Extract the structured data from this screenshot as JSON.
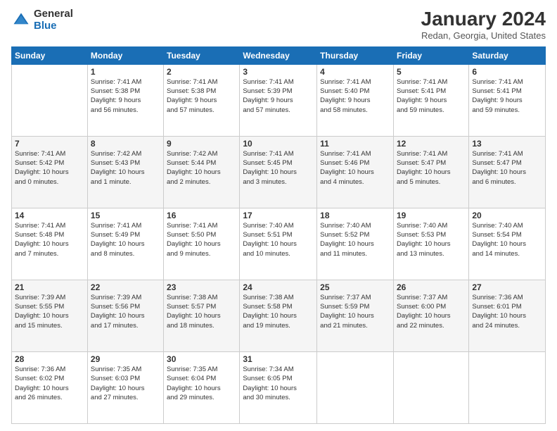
{
  "logo": {
    "general": "General",
    "blue": "Blue"
  },
  "title": "January 2024",
  "location": "Redan, Georgia, United States",
  "days_header": [
    "Sunday",
    "Monday",
    "Tuesday",
    "Wednesday",
    "Thursday",
    "Friday",
    "Saturday"
  ],
  "weeks": [
    [
      {
        "num": "",
        "info": ""
      },
      {
        "num": "1",
        "info": "Sunrise: 7:41 AM\nSunset: 5:38 PM\nDaylight: 9 hours\nand 56 minutes."
      },
      {
        "num": "2",
        "info": "Sunrise: 7:41 AM\nSunset: 5:38 PM\nDaylight: 9 hours\nand 57 minutes."
      },
      {
        "num": "3",
        "info": "Sunrise: 7:41 AM\nSunset: 5:39 PM\nDaylight: 9 hours\nand 57 minutes."
      },
      {
        "num": "4",
        "info": "Sunrise: 7:41 AM\nSunset: 5:40 PM\nDaylight: 9 hours\nand 58 minutes."
      },
      {
        "num": "5",
        "info": "Sunrise: 7:41 AM\nSunset: 5:41 PM\nDaylight: 9 hours\nand 59 minutes."
      },
      {
        "num": "6",
        "info": "Sunrise: 7:41 AM\nSunset: 5:41 PM\nDaylight: 9 hours\nand 59 minutes."
      }
    ],
    [
      {
        "num": "7",
        "info": "Sunrise: 7:41 AM\nSunset: 5:42 PM\nDaylight: 10 hours\nand 0 minutes."
      },
      {
        "num": "8",
        "info": "Sunrise: 7:42 AM\nSunset: 5:43 PM\nDaylight: 10 hours\nand 1 minute."
      },
      {
        "num": "9",
        "info": "Sunrise: 7:42 AM\nSunset: 5:44 PM\nDaylight: 10 hours\nand 2 minutes."
      },
      {
        "num": "10",
        "info": "Sunrise: 7:41 AM\nSunset: 5:45 PM\nDaylight: 10 hours\nand 3 minutes."
      },
      {
        "num": "11",
        "info": "Sunrise: 7:41 AM\nSunset: 5:46 PM\nDaylight: 10 hours\nand 4 minutes."
      },
      {
        "num": "12",
        "info": "Sunrise: 7:41 AM\nSunset: 5:47 PM\nDaylight: 10 hours\nand 5 minutes."
      },
      {
        "num": "13",
        "info": "Sunrise: 7:41 AM\nSunset: 5:47 PM\nDaylight: 10 hours\nand 6 minutes."
      }
    ],
    [
      {
        "num": "14",
        "info": "Sunrise: 7:41 AM\nSunset: 5:48 PM\nDaylight: 10 hours\nand 7 minutes."
      },
      {
        "num": "15",
        "info": "Sunrise: 7:41 AM\nSunset: 5:49 PM\nDaylight: 10 hours\nand 8 minutes."
      },
      {
        "num": "16",
        "info": "Sunrise: 7:41 AM\nSunset: 5:50 PM\nDaylight: 10 hours\nand 9 minutes."
      },
      {
        "num": "17",
        "info": "Sunrise: 7:40 AM\nSunset: 5:51 PM\nDaylight: 10 hours\nand 10 minutes."
      },
      {
        "num": "18",
        "info": "Sunrise: 7:40 AM\nSunset: 5:52 PM\nDaylight: 10 hours\nand 11 minutes."
      },
      {
        "num": "19",
        "info": "Sunrise: 7:40 AM\nSunset: 5:53 PM\nDaylight: 10 hours\nand 13 minutes."
      },
      {
        "num": "20",
        "info": "Sunrise: 7:40 AM\nSunset: 5:54 PM\nDaylight: 10 hours\nand 14 minutes."
      }
    ],
    [
      {
        "num": "21",
        "info": "Sunrise: 7:39 AM\nSunset: 5:55 PM\nDaylight: 10 hours\nand 15 minutes."
      },
      {
        "num": "22",
        "info": "Sunrise: 7:39 AM\nSunset: 5:56 PM\nDaylight: 10 hours\nand 17 minutes."
      },
      {
        "num": "23",
        "info": "Sunrise: 7:38 AM\nSunset: 5:57 PM\nDaylight: 10 hours\nand 18 minutes."
      },
      {
        "num": "24",
        "info": "Sunrise: 7:38 AM\nSunset: 5:58 PM\nDaylight: 10 hours\nand 19 minutes."
      },
      {
        "num": "25",
        "info": "Sunrise: 7:37 AM\nSunset: 5:59 PM\nDaylight: 10 hours\nand 21 minutes."
      },
      {
        "num": "26",
        "info": "Sunrise: 7:37 AM\nSunset: 6:00 PM\nDaylight: 10 hours\nand 22 minutes."
      },
      {
        "num": "27",
        "info": "Sunrise: 7:36 AM\nSunset: 6:01 PM\nDaylight: 10 hours\nand 24 minutes."
      }
    ],
    [
      {
        "num": "28",
        "info": "Sunrise: 7:36 AM\nSunset: 6:02 PM\nDaylight: 10 hours\nand 26 minutes."
      },
      {
        "num": "29",
        "info": "Sunrise: 7:35 AM\nSunset: 6:03 PM\nDaylight: 10 hours\nand 27 minutes."
      },
      {
        "num": "30",
        "info": "Sunrise: 7:35 AM\nSunset: 6:04 PM\nDaylight: 10 hours\nand 29 minutes."
      },
      {
        "num": "31",
        "info": "Sunrise: 7:34 AM\nSunset: 6:05 PM\nDaylight: 10 hours\nand 30 minutes."
      },
      {
        "num": "",
        "info": ""
      },
      {
        "num": "",
        "info": ""
      },
      {
        "num": "",
        "info": ""
      }
    ]
  ]
}
